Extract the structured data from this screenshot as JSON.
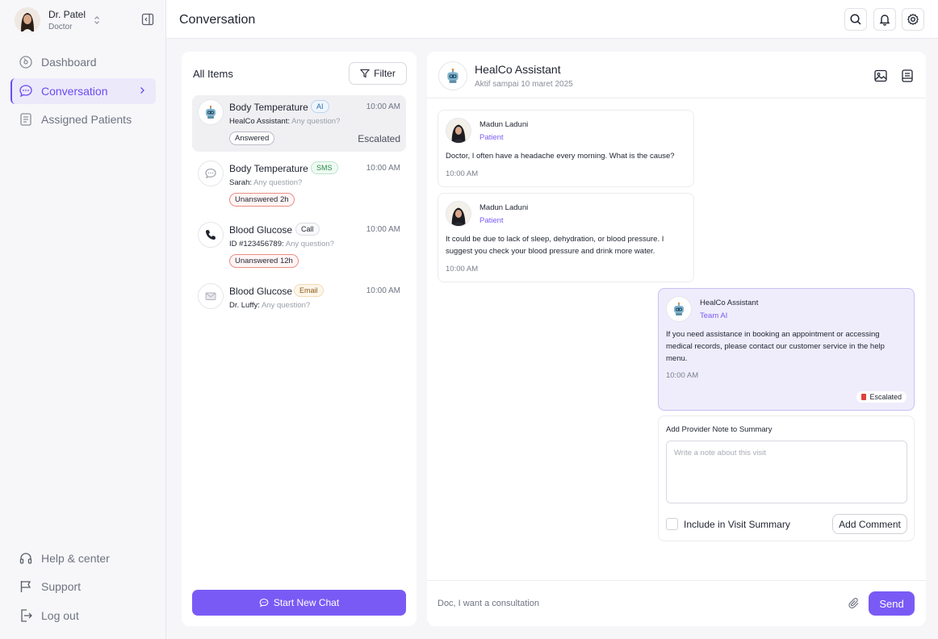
{
  "user": {
    "name": "Dr. Patel",
    "role": "Doctor"
  },
  "sidebar": {
    "items": [
      {
        "label": "Dashboard",
        "icon": "dashboard-icon"
      },
      {
        "label": "Conversation",
        "icon": "chat-icon",
        "active": true
      },
      {
        "label": "Assigned Patients",
        "icon": "document-icon"
      }
    ],
    "footer": [
      {
        "label": "Help & center",
        "icon": "headset-icon"
      },
      {
        "label": "Support",
        "icon": "flag-icon"
      },
      {
        "label": "Log out",
        "icon": "logout-icon"
      }
    ]
  },
  "header": {
    "title": "Conversation"
  },
  "list": {
    "title": "All Items",
    "filter_label": "Filter",
    "items": [
      {
        "title": "Body Temperature",
        "tag": "AI",
        "time": "10:00 AM",
        "sender": "HealCo Assistant:",
        "preview": "Any question?",
        "status": "Answered",
        "escalated": "Escalated",
        "icon": "robot-icon"
      },
      {
        "title": "Body Temperature",
        "tag": "SMS",
        "time": "10:00 AM",
        "sender": "Sarah:",
        "preview": "Any question?",
        "status": "Unanswered 2h",
        "icon": "sms-icon"
      },
      {
        "title": "Blood Glucose",
        "tag": "Call",
        "time": "10:00 AM",
        "sender": "ID #123456789:",
        "preview": "Any question?",
        "status": "Unanswered 12h",
        "icon": "phone-icon"
      },
      {
        "title": "Blood Glucose",
        "tag": "Email",
        "time": "10:00 AM",
        "sender": "Dr. Luffy:",
        "preview": "Any question?",
        "icon": "mail-icon"
      }
    ],
    "start_chat_label": "Start New Chat"
  },
  "chat": {
    "name": "HealCo Assistant",
    "status": "Aktif sampai 10 maret 2025",
    "messages": [
      {
        "name": "Madun Laduni",
        "role": "Patient",
        "text": "Doctor, I often have a headache every morning. What is the cause?",
        "time": "10:00 AM"
      },
      {
        "name": "Madun Laduni",
        "role": "Patient",
        "text": "It could be due to lack of sleep, dehydration, or blood pressure. I suggest you check your blood pressure and drink more water.",
        "time": "10:00 AM"
      },
      {
        "name": "HealCo Assistant",
        "role": "Team AI",
        "text": "If you need assistance in booking an appointment or accessing medical records, please contact our customer service in the help menu.",
        "time": "10:00 AM",
        "badge": "Escalated"
      }
    ],
    "note": {
      "title": "Add Provider Note to Summary",
      "placeholder": "Write a note about this visit",
      "checkbox_label": "Include in Visit Summary",
      "button_label": "Add Comment"
    },
    "composer": {
      "placeholder": "Doc, I want a consultation",
      "send_label": "Send"
    }
  },
  "colors": {
    "accent": "#7a5af5",
    "accent_light": "#efedfb",
    "escalated_flag": "#e0413a"
  }
}
